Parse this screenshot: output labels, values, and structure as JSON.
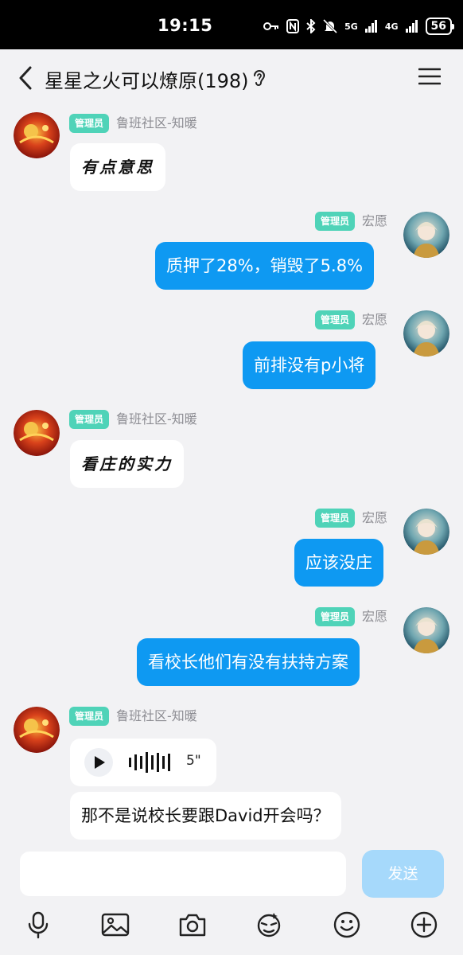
{
  "status_bar": {
    "time": "19:15",
    "network1": "5G",
    "network2": "4G",
    "battery": "56",
    "icons": [
      "key-icon",
      "nfc-icon",
      "bluetooth-icon",
      "mute-icon",
      "signal-icon",
      "battery-icon"
    ]
  },
  "header": {
    "title": "星星之火可以燎原(198)",
    "icons": [
      "back-icon",
      "ear-icon",
      "menu-icon"
    ]
  },
  "messages": [
    {
      "sender": "鲁班社区-知暖",
      "role": "管理员",
      "text": "有点意思",
      "side": "left"
    },
    {
      "sender": "宏愿",
      "role": "管理员",
      "text": "质押了28%，销毁了5.8%",
      "side": "right"
    },
    {
      "sender": "宏愿",
      "role": "管理员",
      "text": "前排没有p小将",
      "side": "right"
    },
    {
      "sender": "鲁班社区-知暖",
      "role": "管理员",
      "text": "看庄的实力",
      "side": "left"
    },
    {
      "sender": "宏愿",
      "role": "管理员",
      "text": "应该没庄",
      "side": "right"
    },
    {
      "sender": "宏愿",
      "role": "管理员",
      "text": "看校长他们有没有扶持方案",
      "side": "right"
    },
    {
      "sender": "鲁班社区-知暖",
      "role": "管理员",
      "voice_duration": "5\"",
      "text": "那不是说校长要跟David开会吗？",
      "side": "left"
    }
  ],
  "input": {
    "value": "",
    "send_label": "发送"
  },
  "toolbar": [
    "microphone-icon",
    "image-icon",
    "camera-icon",
    "sticker-icon",
    "emoji-icon",
    "plus-icon"
  ],
  "colors": {
    "background": "#f2f2f4",
    "bubble_blue": "#0e99f2",
    "badge": "#4fd3b8",
    "send_disabled": "#a6d9fb"
  }
}
